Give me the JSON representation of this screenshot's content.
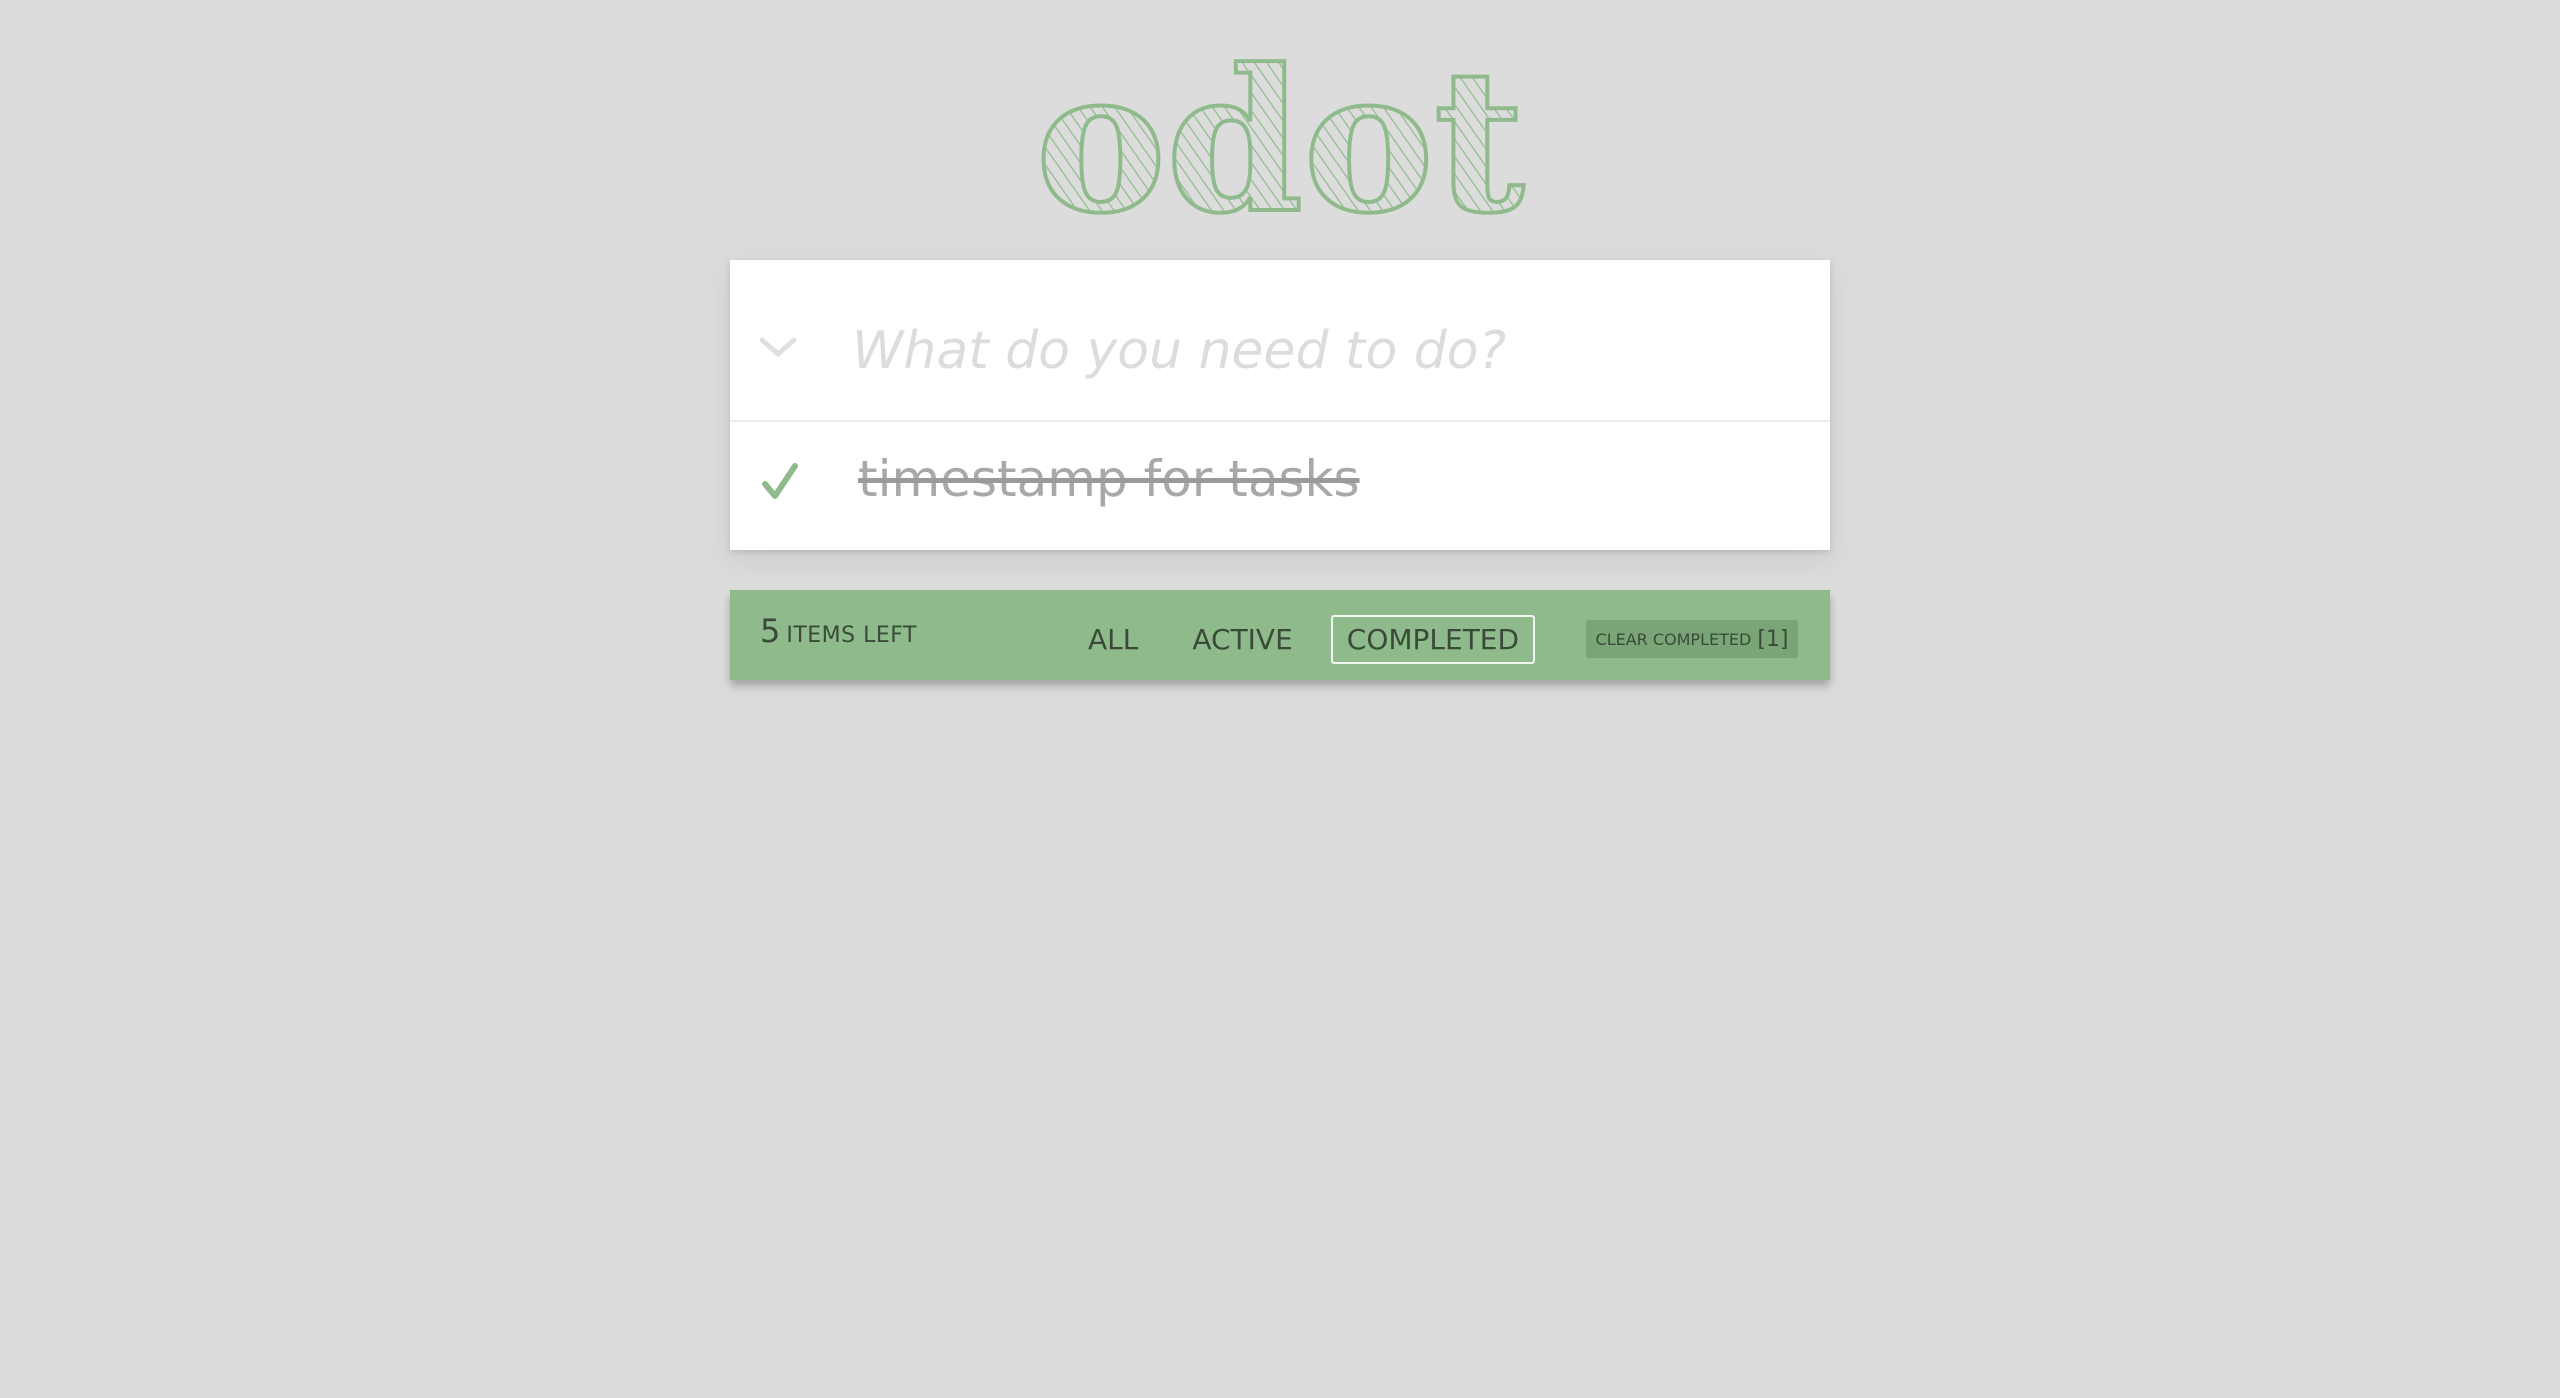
{
  "app": {
    "title": "odot"
  },
  "new_todo": {
    "placeholder": "What do you need to do?",
    "value": ""
  },
  "todos": [
    {
      "text": "timestamp for tasks",
      "completed": true
    }
  ],
  "footer": {
    "count": "5",
    "count_label": "items left",
    "filters": [
      {
        "label": "All",
        "selected": false
      },
      {
        "label": "Active",
        "selected": false
      },
      {
        "label": "Completed",
        "selected": true
      }
    ],
    "clear_label": "clear completed",
    "clear_count": "[1]"
  },
  "colors": {
    "background": "#dcdcdc",
    "accent": "#8fbb8c",
    "card": "#ffffff"
  },
  "icons": {
    "toggle_all": "chevron-down-icon",
    "completed_check": "checkmark-icon"
  }
}
